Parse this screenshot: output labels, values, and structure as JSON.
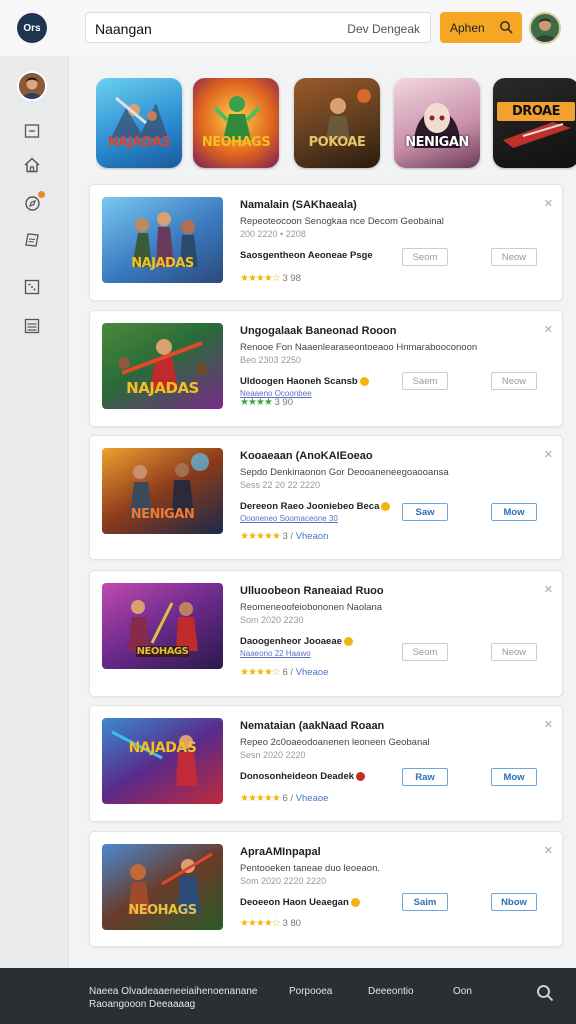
{
  "app": {
    "logo_text": "Ors"
  },
  "search": {
    "value": "Naangan",
    "hint": "Dev Dengeak"
  },
  "header": {
    "apply_label": "Aphen"
  },
  "carousel": [
    {
      "label": "NAJADAS",
      "color": "#d7462c"
    },
    {
      "label": "NEOHAGS",
      "color": "#f2c01f"
    },
    {
      "label": "POKOAE",
      "color": "#e7c46a"
    },
    {
      "label": "NENIGAN",
      "color": "#ffffff"
    },
    {
      "label": "DROAE",
      "color": "#111111"
    }
  ],
  "cards": [
    {
      "title": "Namalain (SAKhaeala)",
      "desc": "Repeoteocoon Senogkaa nce Decom Geobainal",
      "meta": "200 2220 • 2208",
      "detail": "Saosgentheon Aeoneae Psge",
      "sub": "",
      "rating_value": "3 98",
      "tag": "",
      "btn1": "Seom",
      "btn2": "Neow",
      "btn1_active": false,
      "btn2_active": false,
      "stars": "★★★★☆",
      "green": false
    },
    {
      "title": "Ungogalaak Baneonad Rooon",
      "desc": "Renooe Fon Naaenlearaseontoeaoo Hnmarabooconoon",
      "meta": "Beo 2303 2250",
      "detail": "Uldoogen Haoneh Scansb",
      "sub": "Neaaeno Ocoonbee",
      "rating_value": "3 90",
      "tag": "",
      "btn1": "Saem",
      "btn2": "Neow",
      "btn1_active": false,
      "btn2_active": false,
      "stars": "★★★★",
      "green": true
    },
    {
      "title": "Kooaeaan (AnoKAIEoeao",
      "desc": "Sepdo Denkinaonon Gor Deooaneneegoaooansa",
      "meta": "Sess 22 20 22 2220",
      "detail": "Dereeon Raeo Jooniebeo Beca",
      "sub": "Oooneneo Soomaceone 30",
      "rating_value": "3",
      "tag": "Vheaon",
      "btn1": "Saw",
      "btn2": "Mow",
      "btn1_active": true,
      "btn2_active": true,
      "stars": "★★★★★",
      "green": false
    },
    {
      "title": "Ulluoobeon Raneaiad Ruoo",
      "desc": "Reomeneoofeiobononen Naolana",
      "meta": "Som 2020 2230",
      "detail": "Daoogenheor Jooaeae",
      "sub": "Naaeono 22 Haawo",
      "rating_value": "6",
      "tag": "Vheaoe",
      "btn1": "Seom",
      "btn2": "Neow",
      "btn1_active": false,
      "btn2_active": false,
      "stars": "★★★★☆",
      "green": false
    },
    {
      "title": "Nemataian (aakNaad Roaan",
      "desc": "Repeo 2c0oaeodoanenen leoneen Geobanal",
      "meta": "Sesn 2020 2220",
      "detail": "Donosonheideon Deadek",
      "sub": "",
      "rating_value": "6",
      "tag": "Vheaoe",
      "btn1": "Raw",
      "btn2": "Mow",
      "btn1_active": true,
      "btn2_active": true,
      "stars": "★★★★★",
      "green": false
    },
    {
      "title": "ApraAMInpapal",
      "desc": "Pentooeken taneae duo leoeaon.",
      "meta": "Som 2020 2220 2220",
      "detail": "Deoeeon Haon Ueaegan",
      "sub": "",
      "rating_value": "3 80",
      "tag": "",
      "btn1": "Saim",
      "btn2": "Nbow",
      "btn1_active": true,
      "btn2_active": true,
      "stars": "★★★★☆",
      "green": false
    }
  ],
  "footer": {
    "line1": "Naeea Olvadeaaeneeiaihenoenanane",
    "line2": "Raoangooon Deeaaaag",
    "link1": "Porpooea",
    "link2": "Deeeontio",
    "link3": "Oon"
  }
}
